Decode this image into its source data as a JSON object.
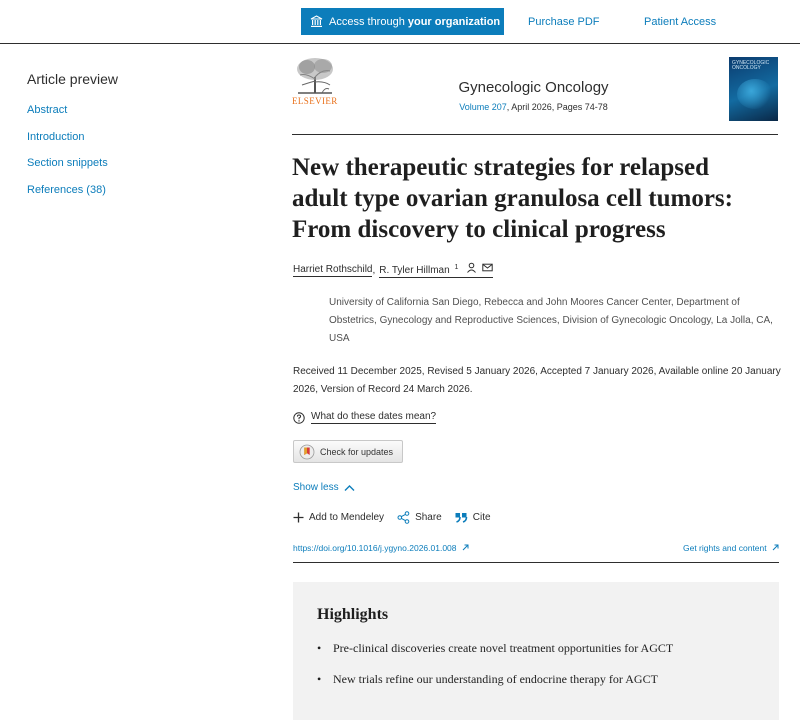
{
  "topbar": {
    "access_prefix": "Access through ",
    "access_bold": "your organization",
    "purchase_pdf": "Purchase PDF",
    "patient_access": "Patient Access"
  },
  "nav": {
    "title": "Article preview",
    "items": [
      {
        "label": "Abstract"
      },
      {
        "label": "Introduction"
      },
      {
        "label": "Section snippets"
      },
      {
        "label": "References (38)"
      }
    ]
  },
  "journal": {
    "publisher": "ELSEVIER",
    "name": "Gynecologic Oncology",
    "volume_link": "Volume 207",
    "details": ", April 2026, Pages 74-78",
    "cover_text": "GYNECOLOGIC ONCOLOGY"
  },
  "article": {
    "title": "New therapeutic strategies for relapsed adult type ovarian granulosa cell tumors: From discovery to clinical progress",
    "authors": [
      {
        "name": "Harriet Rothschild"
      },
      {
        "name": "R. Tyler Hillman",
        "sup": "1"
      }
    ],
    "author_separator": ",",
    "affiliation": "University of California San Diego, Rebecca and John Moores Cancer Center, Department of Obstetrics, Gynecology and Reproductive Sciences, Division of Gynecologic Oncology, La Jolla, CA, USA",
    "dates": "Received 11 December 2025, Revised 5 January 2026, Accepted 7 January 2026, Available online 20 January 2026, Version of Record 24 March 2026.",
    "dates_help": "What do these dates mean?",
    "check_updates": "Check for updates",
    "show_less": "Show less",
    "actions": {
      "mendeley": "Add to Mendeley",
      "share": "Share",
      "cite": "Cite"
    },
    "doi": "https://doi.org/10.1016/j.ygyno.2026.01.008",
    "rights": "Get rights and content"
  },
  "highlights": {
    "title": "Highlights",
    "items": [
      "Pre-clinical discoveries create novel treatment opportunities for AGCT",
      "New trials refine our understanding of endocrine therapy for AGCT"
    ]
  },
  "colors": {
    "accent": "#0c7dbb",
    "publisher_orange": "#e9711c",
    "highlights_bg": "#f2f2f2"
  },
  "icons": [
    "institution-icon",
    "external-link-icon",
    "person-icon",
    "mail-icon",
    "question-circle-icon",
    "crossmark-icon",
    "chevron-up-icon",
    "plus-icon",
    "share-icon",
    "quote-icon"
  ]
}
